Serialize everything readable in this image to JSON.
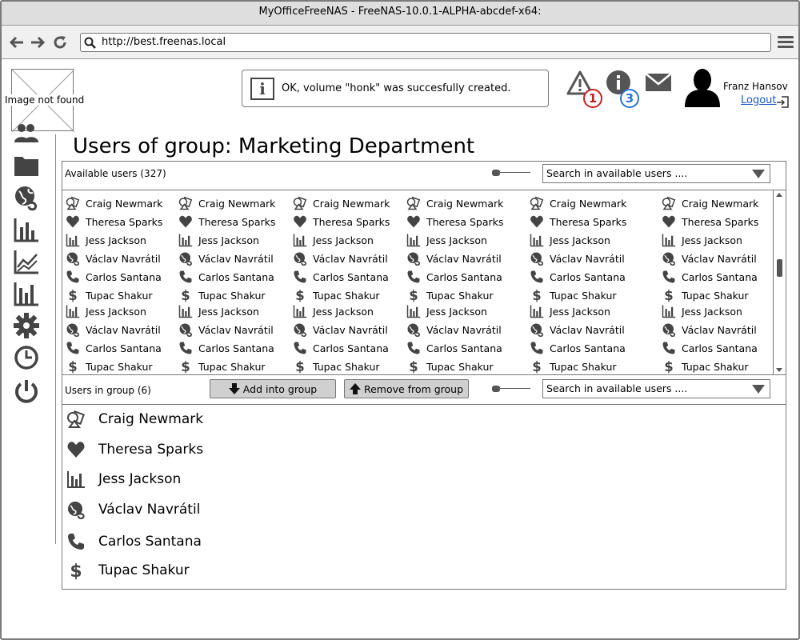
{
  "window": {
    "title": "MyOfficeFreeNAS - FreeNAS-10.0.1-ALPHA-abcdef-x64:"
  },
  "browser": {
    "url": "http://best.freenas.local"
  },
  "logo": {
    "alt": "Image not found"
  },
  "sidebar": {
    "icons": [
      "users-icon",
      "folder-icon",
      "globe-icon",
      "bar-chart-icon",
      "line-chart-icon",
      "stats-icon",
      "gear-icon",
      "clock-icon",
      "power-icon"
    ]
  },
  "notification": {
    "message": "OK, volume \"honk\" was succesfully created."
  },
  "header": {
    "warnings_count": "1",
    "info_count": "3",
    "user_name": "Franz Hansov",
    "logout_label": "Logout"
  },
  "page": {
    "title": "Users of group: Marketing Department"
  },
  "available": {
    "label": "Available users (327)",
    "search_placeholder": "Search in available users ....",
    "users": [
      {
        "name": "Craig Newmark",
        "icon": "shapes-icon"
      },
      {
        "name": "Theresa Sparks",
        "icon": "heart-icon"
      },
      {
        "name": "Jess Jackson",
        "icon": "bar-chart-icon"
      },
      {
        "name": "Václav Navrátil",
        "icon": "globe-icon"
      },
      {
        "name": "Carlos Santana",
        "icon": "phone-icon"
      },
      {
        "name": "Tupac Shakur",
        "icon": "dollar-icon"
      },
      {
        "name": "Jess Jackson",
        "icon": "bar-chart-icon"
      },
      {
        "name": "Václav Navrátil",
        "icon": "globe-icon"
      },
      {
        "name": "Carlos Santana",
        "icon": "phone-icon"
      },
      {
        "name": "Tupac Shakur",
        "icon": "dollar-icon"
      }
    ]
  },
  "actions": {
    "add_label": "Add into group",
    "remove_label": "Remove from group"
  },
  "group": {
    "label": "Users in group  (6)",
    "search_placeholder": "Search in available users ....",
    "members": [
      {
        "name": "Craig Newmark",
        "icon": "shapes-icon"
      },
      {
        "name": "Theresa Sparks",
        "icon": "heart-icon"
      },
      {
        "name": "Jess Jackson",
        "icon": "bar-chart-icon"
      },
      {
        "name": "Václav Navrátil",
        "icon": "globe-icon"
      },
      {
        "name": "Carlos Santana",
        "icon": "phone-icon"
      },
      {
        "name": "Tupac Shakur",
        "icon": "dollar-icon"
      }
    ]
  },
  "colors": {
    "warning_badge": "#cc1f1f",
    "info_badge": "#2a72d6",
    "link": "#1a56c8",
    "icon": "#444444"
  }
}
